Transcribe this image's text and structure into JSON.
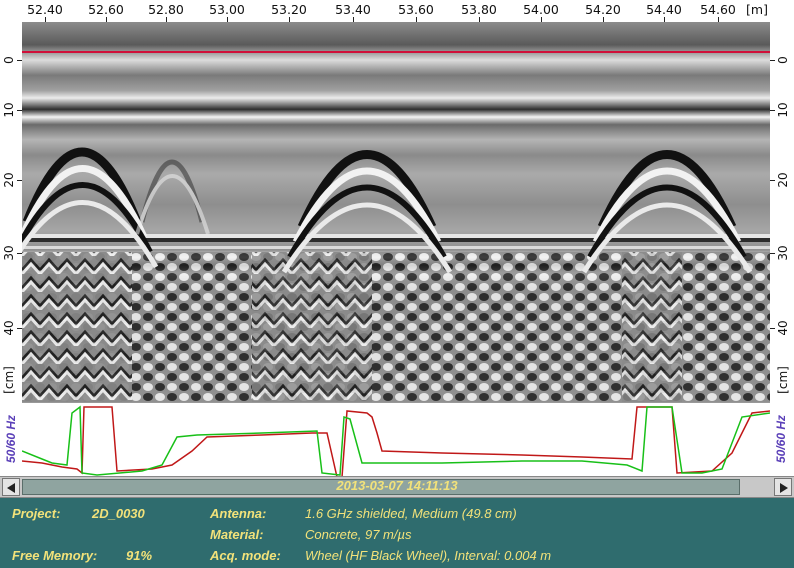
{
  "top_axis": {
    "ticks": [
      "52.40",
      "52.60",
      "52.80",
      "53.00",
      "53.20",
      "53.40",
      "53.60",
      "53.80",
      "54.00",
      "54.20",
      "54.40",
      "54.60"
    ],
    "unit": "[m]"
  },
  "depth_axis": {
    "ticks": [
      "0",
      "10",
      "20",
      "30",
      "40"
    ],
    "unit": "[cm]"
  },
  "signal_panel": {
    "label": "50/60 Hz"
  },
  "scrollbar": {
    "timestamp": "2013-03-07   14:11:13"
  },
  "info": {
    "project_label": "Project:",
    "project_value": "2D_0030",
    "memory_label": "Free Memory:",
    "memory_value": "91%",
    "antenna_label": "Antenna:",
    "antenna_value": "1.6 GHz shielded, Medium (49.8 cm)",
    "material_label": "Material:",
    "material_value": "Concrete, 97 m/µs",
    "acq_label": "Acq. mode:",
    "acq_value": "Wheel (HF Black Wheel), Interval: 0.004 m"
  },
  "colors": {
    "surface_line": "#d0103a",
    "signal_red": "#c01818",
    "signal_green": "#18c018",
    "info_bg": "#2f6c6e",
    "info_text": "#f2e27a",
    "hz_label": "#5a3fb8"
  }
}
